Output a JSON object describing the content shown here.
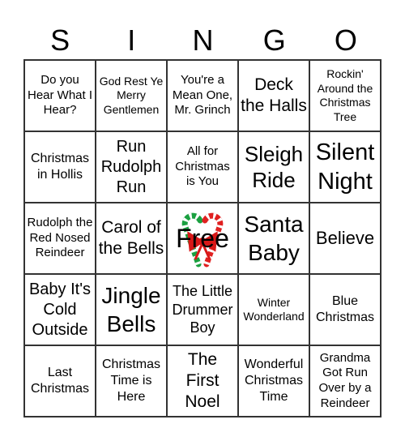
{
  "header": [
    "S",
    "I",
    "N",
    "G",
    "O"
  ],
  "cells": [
    "Do you Hear What I Hear?",
    "God Rest Ye Merry Gentlemen",
    "You're a Mean One, Mr. Grinch",
    "Deck the Halls",
    "Rockin' Around the Christmas Tree",
    "Christmas in Hollis",
    "Run Rudolph Run",
    "All for Christmas is You",
    "Sleigh Ride",
    "Silent Night",
    "Rudolph the Red Nosed Reindeer",
    "Carol of the Bells",
    "Free",
    "Santa Baby",
    "Believe",
    "Baby It's Cold Outside",
    "Jingle Bells",
    "The Little Drummer Boy",
    "Winter Wonderland",
    "Blue Christmas",
    "Last Christmas",
    "Christmas Time is Here",
    "The First Noel",
    "Wonderful Christmas Time",
    "Grandma Got Run Over by a Reindeer"
  ],
  "free_icon": "candy-canes-with-bow-icon",
  "colors": {
    "cane_red": "#e02020",
    "cane_green": "#1aa040",
    "bow": "#d81818"
  }
}
